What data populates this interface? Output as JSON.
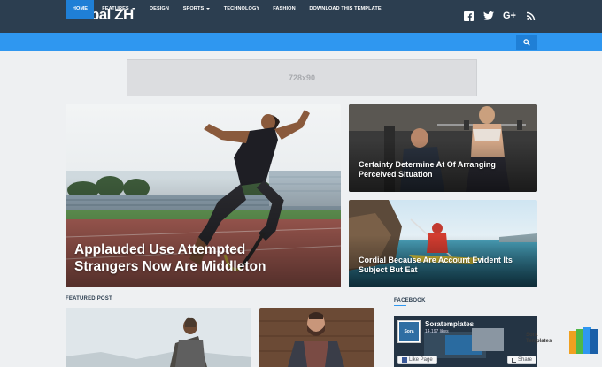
{
  "header": {
    "logo": "Global ZH",
    "social": [
      {
        "name": "facebook-icon",
        "glyph": "f"
      },
      {
        "name": "twitter-icon",
        "glyph": "t"
      },
      {
        "name": "google-plus-icon",
        "glyph": "G+"
      },
      {
        "name": "rss-icon",
        "glyph": "rss"
      }
    ]
  },
  "nav": {
    "items": [
      {
        "label": "Home",
        "active": true
      },
      {
        "label": "Features",
        "dropdown": true
      },
      {
        "label": "Design"
      },
      {
        "label": "Sports",
        "dropdown": true
      },
      {
        "label": "Technology"
      },
      {
        "label": "Fashion"
      },
      {
        "label": "Download This Template"
      }
    ]
  },
  "ad": {
    "label": "728x90"
  },
  "hero": {
    "main_title": "Applauded Use Attempted Strangers Now Are Middleton",
    "side_top_title": "Certainty Determine At Of Arranging Perceived Situation",
    "side_bottom_title": "Cordial Because Are Account Evident Its Subject But Eat"
  },
  "sections": {
    "featured": "Featured Post",
    "facebook": "Facebook"
  },
  "fb_widget": {
    "page_name": "Soratemplates",
    "likes": "14,197 likes",
    "like_btn": "Like Page",
    "share_btn": "Share",
    "brand": "Sora Templates",
    "thumb_text": "Sora"
  },
  "colors": {
    "topbar": "#2c3e50",
    "nav": "#2f97f0",
    "accent": "#2f97f0"
  }
}
